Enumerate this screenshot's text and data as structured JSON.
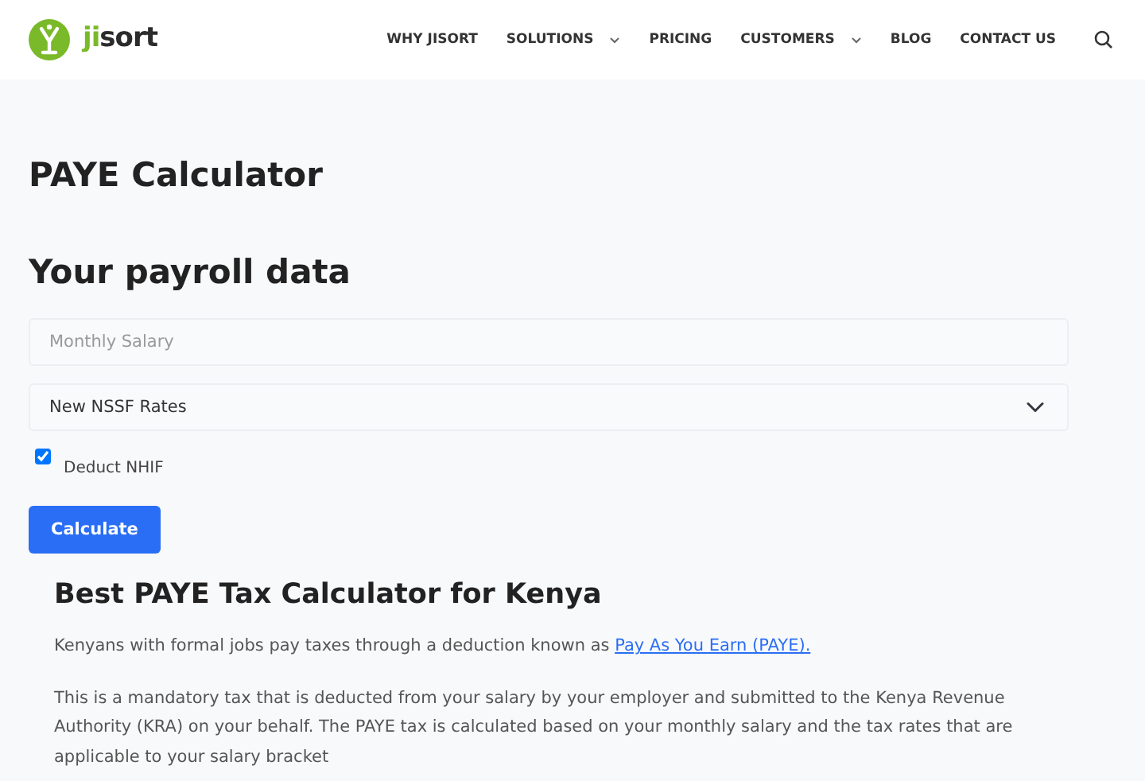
{
  "header": {
    "logo": {
      "parts": [
        {
          "text": "ji",
          "color": "#7ab929"
        },
        {
          "text": "sort",
          "color": "#2b2b2b"
        }
      ]
    },
    "nav": [
      {
        "label": "WHY JISORT",
        "dropdown": false
      },
      {
        "label": "SOLUTIONS",
        "dropdown": true
      },
      {
        "label": "PRICING",
        "dropdown": false
      },
      {
        "label": "CUSTOMERS",
        "dropdown": true
      },
      {
        "label": "BLOG",
        "dropdown": false
      },
      {
        "label": "CONTACT US",
        "dropdown": false
      }
    ]
  },
  "page_title": "PAYE Calculator",
  "form": {
    "title": "Your payroll data",
    "salary": {
      "placeholder": "Monthly Salary"
    },
    "nssf": {
      "value": "New NSSF Rates"
    },
    "deduct_nhif": {
      "label": "Deduct NHIF",
      "checked": true
    },
    "button": "Calculate"
  },
  "article": {
    "heading": "Best PAYE Tax Calculator for Kenya",
    "paragraphs": [
      {
        "text": "Kenyans with formal jobs pay taxes through a deduction known as ",
        "link": "Pay As You Earn (PAYE)."
      },
      {
        "text": "This is a mandatory tax that is deducted from your salary by your employer and submitted to the Kenya Revenue Authority (KRA) on your behalf. The PAYE tax is calculated based on your monthly salary and the tax rates that are applicable to your salary bracket"
      }
    ]
  }
}
